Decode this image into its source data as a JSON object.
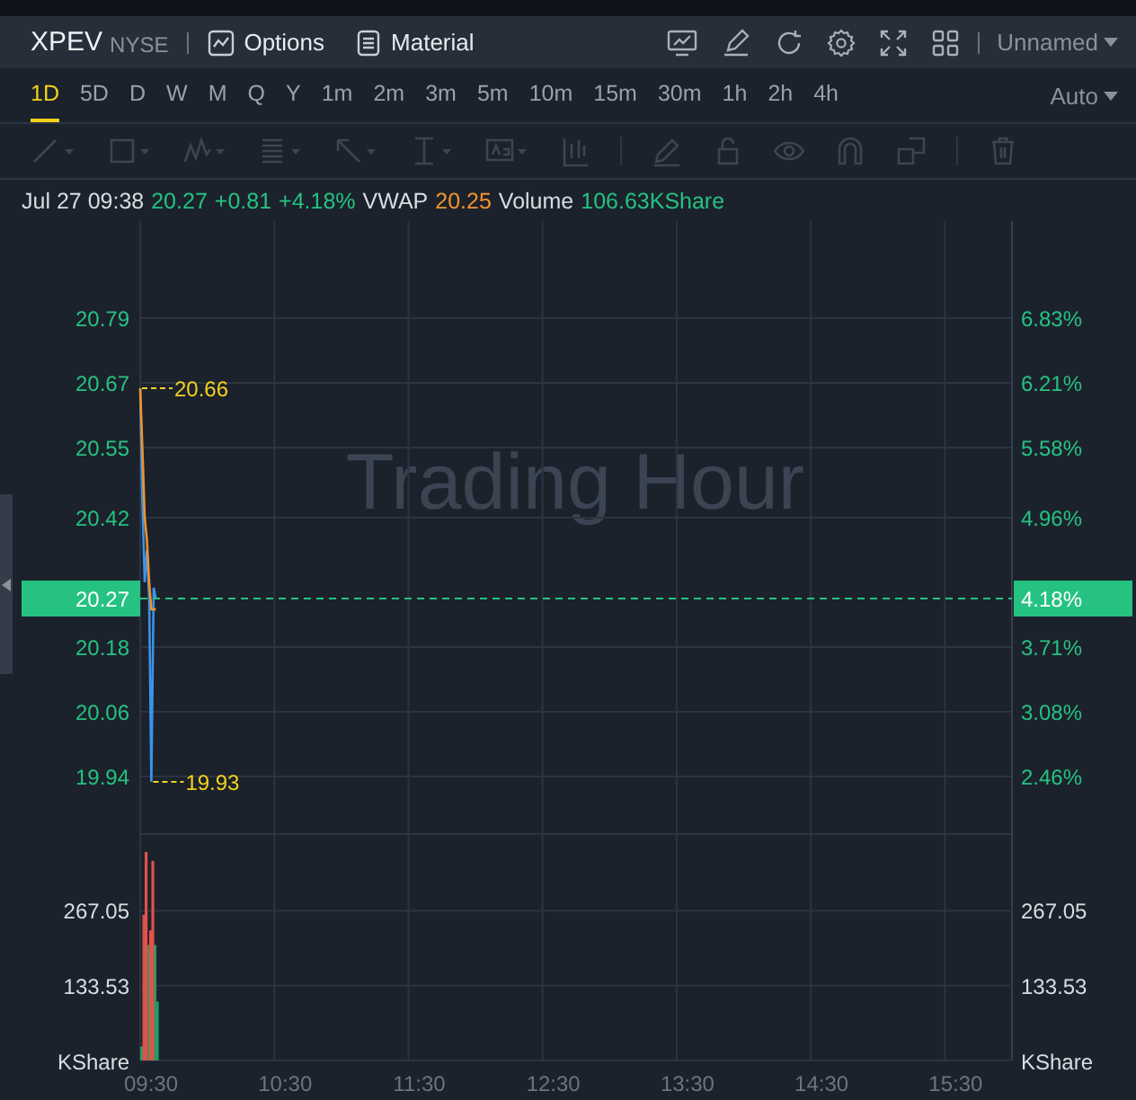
{
  "header": {
    "symbol": "XPEV",
    "exchange": "NYSE",
    "buttons": [
      {
        "label": "Options",
        "kind": "options"
      },
      {
        "label": "Material",
        "kind": "material"
      }
    ],
    "layout_menu": "Unnamed"
  },
  "timeframes": [
    {
      "label": "1D",
      "selected": true
    },
    {
      "label": "5D",
      "selected": false
    },
    {
      "label": "D",
      "selected": false
    },
    {
      "label": "W",
      "selected": false
    },
    {
      "label": "M",
      "selected": false
    },
    {
      "label": "Q",
      "selected": false
    },
    {
      "label": "Y",
      "selected": false
    },
    {
      "label": "1m",
      "selected": false
    },
    {
      "label": "2m",
      "selected": false
    },
    {
      "label": "3m",
      "selected": false
    },
    {
      "label": "5m",
      "selected": false
    },
    {
      "label": "10m",
      "selected": false
    },
    {
      "label": "15m",
      "selected": false
    },
    {
      "label": "30m",
      "selected": false
    },
    {
      "label": "1h",
      "selected": false
    },
    {
      "label": "2h",
      "selected": false
    },
    {
      "label": "4h",
      "selected": false
    }
  ],
  "scale_menu": "Auto",
  "drawing_toolbar": {
    "disabled": true
  },
  "info_line": {
    "items": [
      {
        "text": "Jul 27 09:38",
        "color": "#d9dde3"
      },
      {
        "text": "20.27",
        "color": "#26c281"
      },
      {
        "text": "+0.81",
        "color": "#26c281"
      },
      {
        "text": "+4.18%",
        "color": "#26c281"
      },
      {
        "text": "VWAP",
        "color": "#d9dde3"
      },
      {
        "text": "20.25",
        "color": "#f5922f"
      },
      {
        "text": "Volume",
        "color": "#d9dde3"
      },
      {
        "text": "106.63KShare",
        "color": "#26c281"
      }
    ]
  },
  "price_panel": {
    "watermark": "Trading Hour",
    "right_axis_labels": [
      "6.83%",
      "6.21%",
      "5.58%",
      "4.96%",
      "3.71%",
      "3.08%",
      "2.46%"
    ],
    "current_percent": "4.18%",
    "markers": [
      {
        "kind": "high",
        "text": "20.66"
      },
      {
        "kind": "low",
        "text": "19.93"
      },
      {
        "kind": "current",
        "text": "20.27"
      }
    ],
    "price_labels": [
      "20.79",
      "20.67",
      "20.55",
      "20.42",
      "20.18",
      "20.06",
      "19.94"
    ]
  },
  "volume_panel": {
    "left_unit": "KShare",
    "right_unit": "KShare",
    "right_axis_labels": [
      "267.05",
      "133.53"
    ],
    "left_axis_labels": [
      "267.05",
      "133.53"
    ],
    "time_labels": [
      "09:30",
      "10:30",
      "11:30",
      "12:30",
      "13:30",
      "14:30",
      "15:30"
    ]
  }
}
